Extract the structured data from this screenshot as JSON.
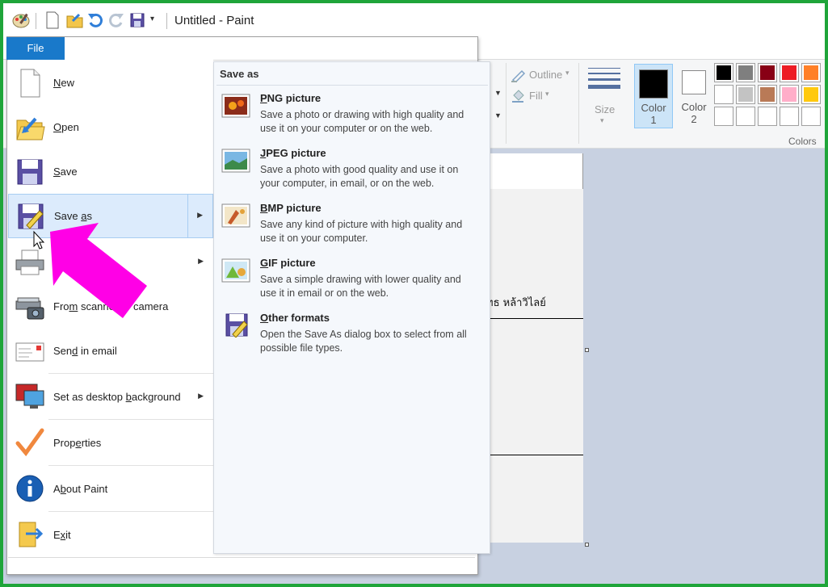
{
  "window": {
    "title": "Untitled - Paint"
  },
  "ribbon": {
    "file_tab": "File",
    "outline": "Outline",
    "fill": "Fill",
    "size": "Size",
    "color1": {
      "label_top": "Color",
      "label_bottom": "1",
      "value": "#000000"
    },
    "color2": {
      "label_top": "Color",
      "label_bottom": "2",
      "value": "#ffffff"
    },
    "colors_label": "Colors",
    "palette": [
      [
        "#000000",
        "#7f7f7f",
        "#880015",
        "#ed1c24",
        "#ff7f27"
      ],
      [
        "#ffffff",
        "#c3c3c3",
        "#b97a57",
        "#ffaec9",
        "#ffc90e"
      ],
      [
        "#ffffff",
        "#ffffff",
        "#ffffff",
        "#ffffff",
        "#ffffff"
      ]
    ]
  },
  "canvas": {
    "text": "ทธ หล้าวิไลย์"
  },
  "file_menu": {
    "items": [
      {
        "pre": "",
        "key": "N",
        "post": "ew"
      },
      {
        "pre": "",
        "key": "O",
        "post": "pen"
      },
      {
        "pre": "",
        "key": "S",
        "post": "ave"
      },
      {
        "pre": "Save ",
        "key": "a",
        "post": "s"
      },
      {
        "pre": "",
        "key": "",
        "post": ""
      },
      {
        "pre": "Fro",
        "key": "m",
        "post": " scanner or camera"
      },
      {
        "pre": "Sen",
        "key": "d",
        "post": " in email"
      },
      {
        "pre": "Set as desktop ",
        "key": "b",
        "post": "ackground"
      },
      {
        "pre": "Prop",
        "key": "e",
        "post": "rties"
      },
      {
        "pre": "A",
        "key": "b",
        "post": "out Paint"
      },
      {
        "pre": "E",
        "key": "x",
        "post": "it"
      }
    ]
  },
  "save_as_menu": {
    "title": "Save as",
    "items": [
      {
        "key": "P",
        "title_rest": "NG picture",
        "desc": "Save a photo or drawing with high quality and use it on your computer or on the web."
      },
      {
        "key": "J",
        "title_rest": "PEG picture",
        "desc": "Save a photo with good quality and use it on your computer, in email, or on the web."
      },
      {
        "key": "B",
        "title_rest": "MP picture",
        "desc": "Save any kind of picture with high quality and use it on your computer."
      },
      {
        "key": "G",
        "title_rest": "IF picture",
        "desc": "Save a simple drawing with lower quality and use it in email or on the web."
      },
      {
        "key": "O",
        "title_rest": "ther formats",
        "desc": "Open the Save As dialog box to select from all possible file types."
      }
    ]
  },
  "accent": {
    "highlight": "#dcebfc",
    "annotation_arrow": "#ff00e6",
    "border": "#1fa53a"
  }
}
